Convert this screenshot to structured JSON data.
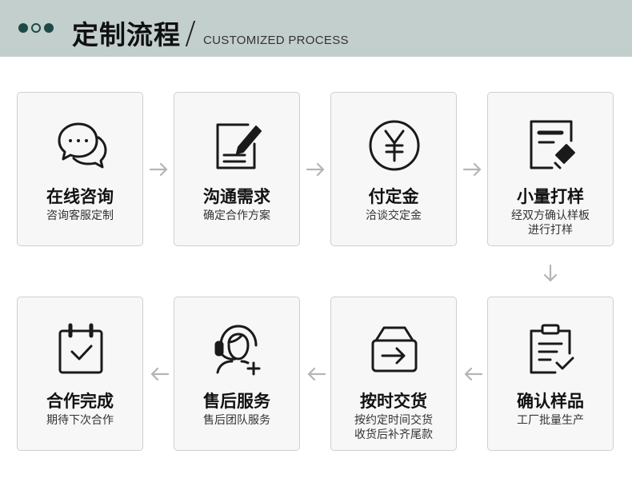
{
  "header": {
    "title": "定制流程",
    "subtitle": "CUSTOMIZED PROCESS"
  },
  "steps": [
    {
      "icon": "chat-bubbles-icon",
      "title": "在线咨询",
      "desc": "咨询客服定制"
    },
    {
      "icon": "edit-document-icon",
      "title": "沟通需求",
      "desc": "确定合作方案"
    },
    {
      "icon": "yen-coin-icon",
      "title": "付定金",
      "desc": "洽谈交定金"
    },
    {
      "icon": "sample-document-icon",
      "title": "小量打样",
      "desc": "经双方确认样板\n进行打样"
    },
    {
      "icon": "clipboard-check-icon",
      "title": "确认样品",
      "desc": "工厂批量生产"
    },
    {
      "icon": "package-arrow-icon",
      "title": "按时交货",
      "desc": "按约定时间交货\n收货后补齐尾款"
    },
    {
      "icon": "customer-service-icon",
      "title": "售后服务",
      "desc": "售后团队服务"
    },
    {
      "icon": "calendar-check-icon",
      "title": "合作完成",
      "desc": "期待下次合作"
    }
  ],
  "colors": {
    "header_bg": "#c3cfcd",
    "dot_color": "#1e4a45",
    "card_bg": "#f7f7f7",
    "arrow_color": "#b5b5b5"
  }
}
